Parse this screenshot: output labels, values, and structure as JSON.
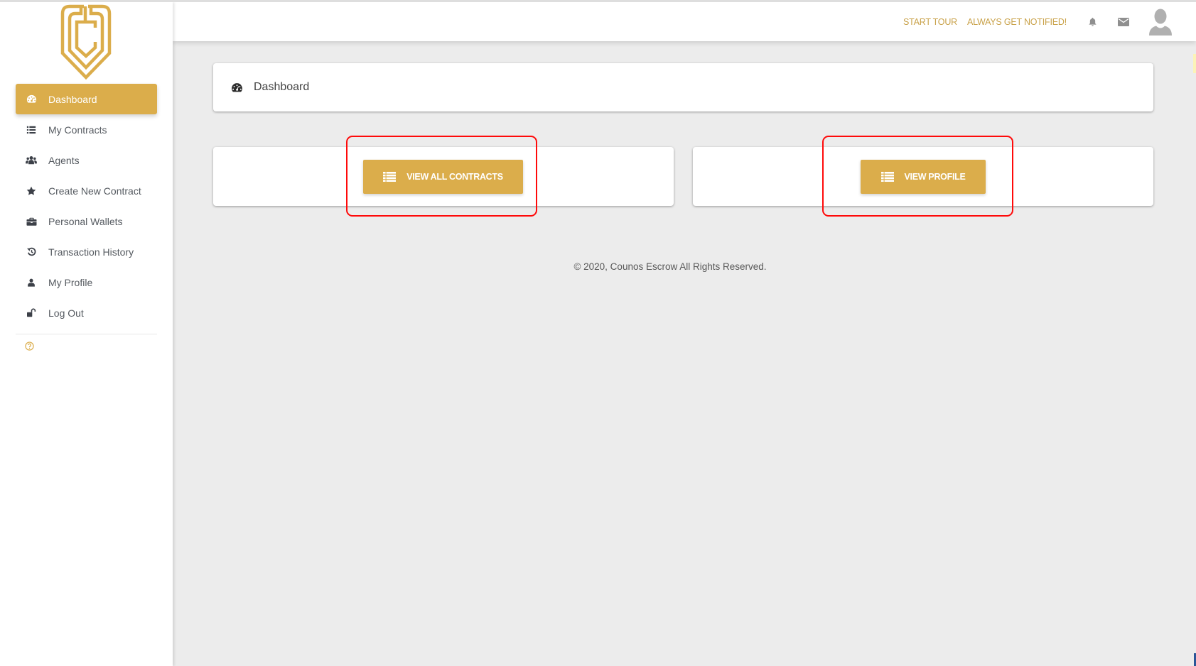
{
  "app": {
    "brand_color": "#dbad4b",
    "name": "Counos Escrow"
  },
  "sidebar": {
    "logo": "counos-shield-logo",
    "items": [
      {
        "label": "Dashboard",
        "icon": "dashboard-gauge-icon",
        "active": true
      },
      {
        "label": "My Contracts",
        "icon": "list-icon",
        "active": false
      },
      {
        "label": "Agents",
        "icon": "users-icon",
        "active": false
      },
      {
        "label": "Create New Contract",
        "icon": "star-icon",
        "active": false
      },
      {
        "label": "Personal Wallets",
        "icon": "briefcase-icon",
        "active": false
      },
      {
        "label": "Transaction History",
        "icon": "history-icon",
        "active": false
      },
      {
        "label": "My Profile",
        "icon": "user-icon",
        "active": false
      },
      {
        "label": "Log Out",
        "icon": "unlock-icon",
        "active": false
      }
    ],
    "help_icon": "question-circle-icon"
  },
  "topbar": {
    "start_tour": "START TOUR",
    "notify": "ALWAYS GET NOTIFIED!",
    "icons": [
      "bell-icon",
      "envelope-icon",
      "avatar-icon"
    ]
  },
  "main": {
    "header": {
      "title": "Dashboard",
      "icon": "dashboard-gauge-icon"
    },
    "buttons": [
      {
        "label": "VIEW ALL CONTRACTS",
        "icon": "list-icon"
      },
      {
        "label": "VIEW PROFILE",
        "icon": "list-icon"
      }
    ],
    "footer": "© 2020, Counos Escrow All Rights Reserved."
  }
}
